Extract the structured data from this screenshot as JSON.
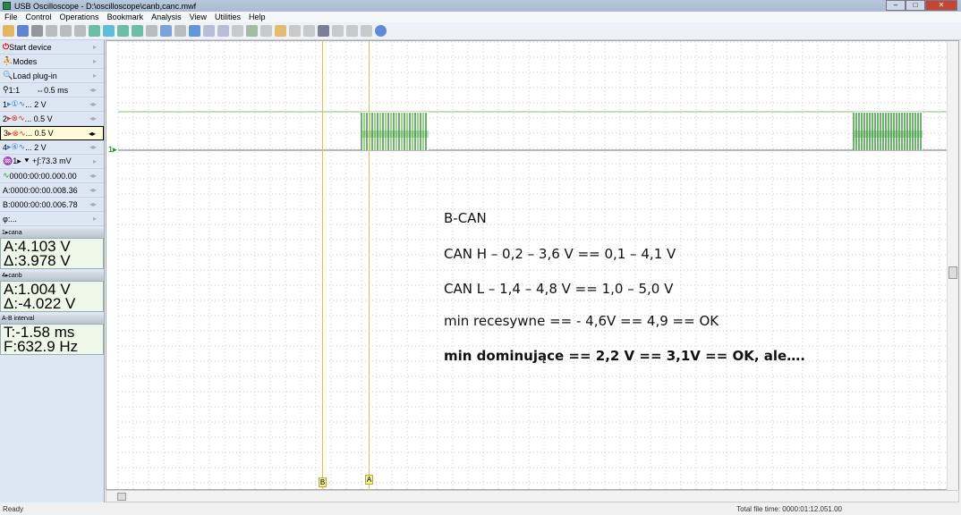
{
  "window": {
    "title": "USB Oscilloscope - D:\\oscilloscope\\canb,canc.mwf",
    "minimize": "–",
    "maximize": "□",
    "close": "✕"
  },
  "menu": [
    "File",
    "Control",
    "Operations",
    "Bookmark",
    "Analysis",
    "View",
    "Utilities",
    "Help"
  ],
  "toolbar_icons": [
    "open-icon",
    "save-icon",
    "print-icon",
    "copy-icon",
    "paste-icon",
    "export-icon",
    "trigger-icon",
    "probe-icon",
    "math-icon",
    "filter-icon",
    "undo-icon",
    "display-icon",
    "bookmark-icon",
    "check-icon",
    "next-icon",
    "prev-icon",
    "page-icon",
    "measure-icon",
    "export-data-icon",
    "decoder-icon",
    "bus-icon",
    "bus2-icon",
    "protocol-icon",
    "stop-icon",
    "pause-icon",
    "clear-icon",
    "help-icon"
  ],
  "left_panel": {
    "start_device": "Start device",
    "modes": "Modes",
    "load_plugin": "Load plug-in",
    "zoom": "1:1",
    "timebase": "0.5 ms",
    "channels": [
      {
        "num": "1",
        "value": "... 2 V"
      },
      {
        "num": "2",
        "value": "... 0.5 V"
      },
      {
        "num": "3",
        "value": "... 0.5 V"
      },
      {
        "num": "4",
        "value": "... 2 V"
      }
    ],
    "trigger": "1▸ ⯆ +∫:73.3 mV",
    "trigger_time": "0000:00:00.000.00",
    "cursor_a": "A:0000:00:00.008.36",
    "cursor_b": "B:0000:00:00.006.78",
    "phi": "φ:...",
    "box1": {
      "header": "1▸cana",
      "a": "A:4.103 V",
      "d": "Δ:3.978 V"
    },
    "box2": {
      "header": "4▸canb",
      "a": "A:1.004 V",
      "d": "Δ:-4.022 V"
    },
    "box3": {
      "header": "A-B interval",
      "t": "T:-1.58 ms",
      "f": "F:632.9 Hz"
    }
  },
  "plot": {
    "channel_marker": "1▸",
    "cursor_a_label": "A",
    "cursor_b_label": "B",
    "notes": [
      "B-CAN",
      "CAN H – 0,2 – 3,6 V == 0,1 – 4,1 V",
      "CAN L – 1,4 – 4,8 V == 1,0 – 5,0 V",
      "min recesywne == - 4,6V == 4,9 == OK",
      "min dominujące == 2,2 V == 3,1V == OK, ale…."
    ],
    "colors": {
      "signal_high": "#7cc46a",
      "signal_burst": "#3a9a3a",
      "baseline": "#707070",
      "cursor": "#d8c060"
    }
  },
  "status": {
    "left": "Ready",
    "right": "Total file time: 0000:01:12.051.00"
  }
}
